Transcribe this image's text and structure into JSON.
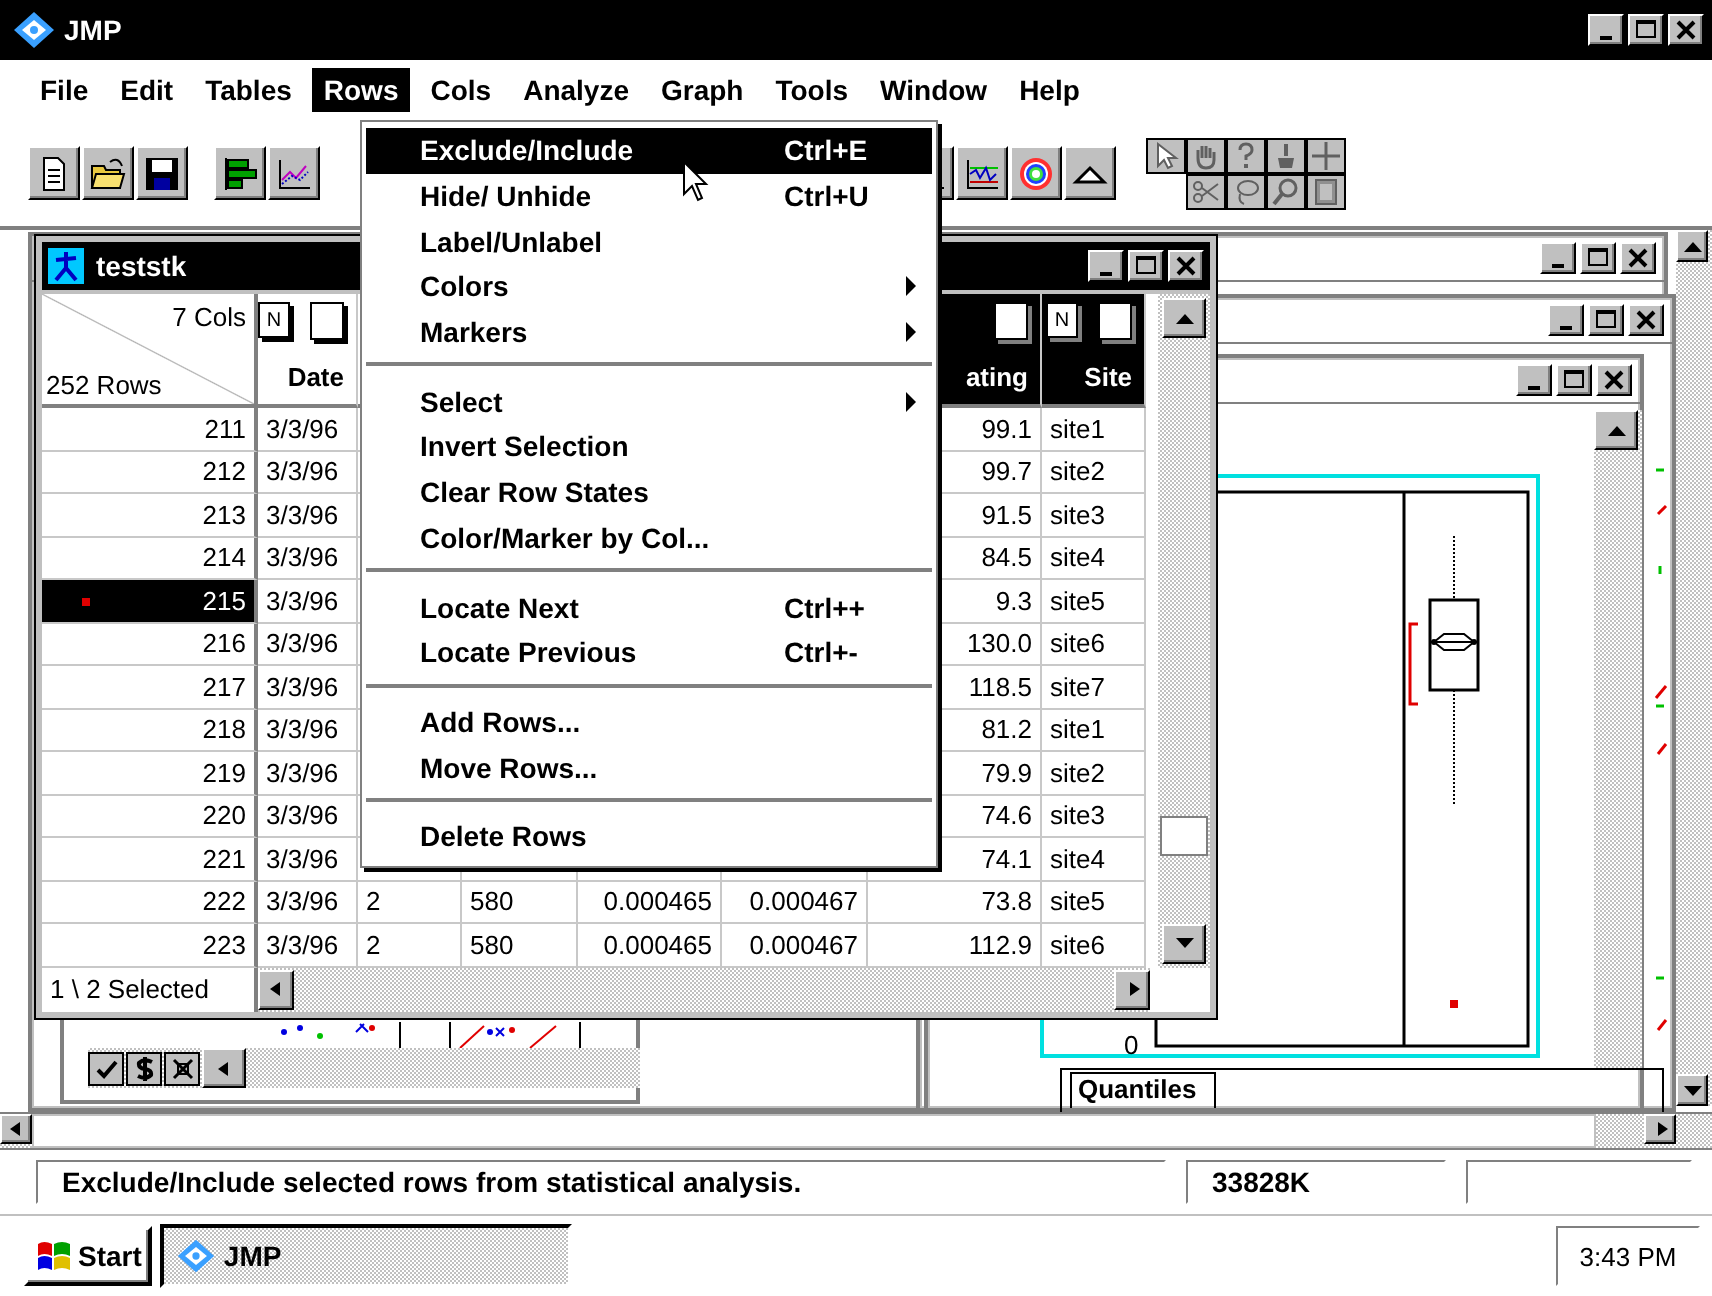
{
  "app": {
    "title": "JMP"
  },
  "menubar": [
    {
      "label": "File",
      "selected": false
    },
    {
      "label": "Edit",
      "selected": false
    },
    {
      "label": "Tables",
      "selected": false
    },
    {
      "label": "Rows",
      "selected": true
    },
    {
      "label": "Cols",
      "selected": false
    },
    {
      "label": "Analyze",
      "selected": false
    },
    {
      "label": "Graph",
      "selected": false
    },
    {
      "label": "Tools",
      "selected": false
    },
    {
      "label": "Window",
      "selected": false
    },
    {
      "label": "Help",
      "selected": false
    }
  ],
  "rows_menu": {
    "items": [
      {
        "kind": "item",
        "label": "Exclude/Include",
        "shortcut": "Ctrl+E",
        "selected": true
      },
      {
        "kind": "item",
        "label": "Hide/ Unhide",
        "shortcut": "Ctrl+U",
        "selected": false
      },
      {
        "kind": "item",
        "label": "Label/Unlabel",
        "selected": false
      },
      {
        "kind": "item",
        "label": "Colors",
        "submenu": true,
        "selected": false
      },
      {
        "kind": "item",
        "label": "Markers",
        "submenu": true,
        "selected": false
      },
      {
        "kind": "separator"
      },
      {
        "kind": "item",
        "label": "Select",
        "submenu": true,
        "selected": false
      },
      {
        "kind": "item",
        "label": "Invert Selection",
        "selected": false
      },
      {
        "kind": "item",
        "label": "Clear Row States",
        "selected": false
      },
      {
        "kind": "item",
        "label": "Color/Marker by Col...",
        "selected": false
      },
      {
        "kind": "separator"
      },
      {
        "kind": "item",
        "label": "Locate Next",
        "shortcut": "Ctrl++",
        "selected": false
      },
      {
        "kind": "item",
        "label": "Locate Previous",
        "shortcut": "Ctrl+-",
        "selected": false
      },
      {
        "kind": "separator"
      },
      {
        "kind": "item",
        "label": "Add Rows...",
        "selected": false
      },
      {
        "kind": "item",
        "label": "Move Rows...",
        "selected": false
      },
      {
        "kind": "separator"
      },
      {
        "kind": "item",
        "label": "Delete Rows",
        "selected": false
      }
    ]
  },
  "data_table": {
    "title": "teststk",
    "cols_count": "7 Cols",
    "rows_count": "252 Rows",
    "columns": {
      "date": {
        "name": "Date",
        "badge": "N",
        "selected": false
      },
      "rating": {
        "name": "ating",
        "selected": true
      },
      "site": {
        "name": "Site",
        "badge": "N",
        "selected": true
      }
    },
    "rows": [
      {
        "row": "211",
        "date": "3/3/96",
        "rating": "99.1",
        "site": "site1",
        "selected": false
      },
      {
        "row": "212",
        "date": "3/3/96",
        "rating": "99.7",
        "site": "site2",
        "selected": false
      },
      {
        "row": "213",
        "date": "3/3/96",
        "rating": "91.5",
        "site": "site3",
        "selected": false
      },
      {
        "row": "214",
        "date": "3/3/96",
        "rating": "84.5",
        "site": "site4",
        "selected": false
      },
      {
        "row": "215",
        "date": "3/3/96",
        "rating": "9.3",
        "site": "site5",
        "selected": true
      },
      {
        "row": "216",
        "date": "3/3/96",
        "rating": "130.0",
        "site": "site6",
        "selected": false
      },
      {
        "row": "217",
        "date": "3/3/96",
        "rating": "118.5",
        "site": "site7",
        "selected": false
      },
      {
        "row": "218",
        "date": "3/3/96",
        "rating": "81.2",
        "site": "site1",
        "selected": false
      },
      {
        "row": "219",
        "date": "3/3/96",
        "rating": "79.9",
        "site": "site2",
        "selected": false
      },
      {
        "row": "220",
        "date": "3/3/96",
        "rating": "74.6",
        "site": "site3",
        "selected": false
      },
      {
        "row": "221",
        "date": "3/3/96",
        "rating": "74.1",
        "site": "site4",
        "selected": false
      },
      {
        "row": "222",
        "date": "3/3/96",
        "column_3": "2",
        "column_4": "580",
        "column_5": "0.000465",
        "column_6": "0.000467",
        "rating": "73.8",
        "site": "site5",
        "selected": false
      },
      {
        "row": "223",
        "date": "3/3/96",
        "column_3": "2",
        "column_4": "580",
        "column_5": "0.000465",
        "column_6": "0.000467",
        "rating": "112.9",
        "site": "site6",
        "selected": false
      }
    ],
    "selection_summary": "1 \\ 2 Selected"
  },
  "analysis": {
    "axis_label": "0",
    "quantiles_heading": "Quantiles"
  },
  "status_bar": {
    "message": "Exclude/Include selected rows from statistical analysis.",
    "memory": "33828K"
  },
  "taskbar": {
    "start": "Start",
    "tasks": [
      {
        "label": "JMP",
        "selected": true
      }
    ],
    "clock": "3:43 PM"
  }
}
